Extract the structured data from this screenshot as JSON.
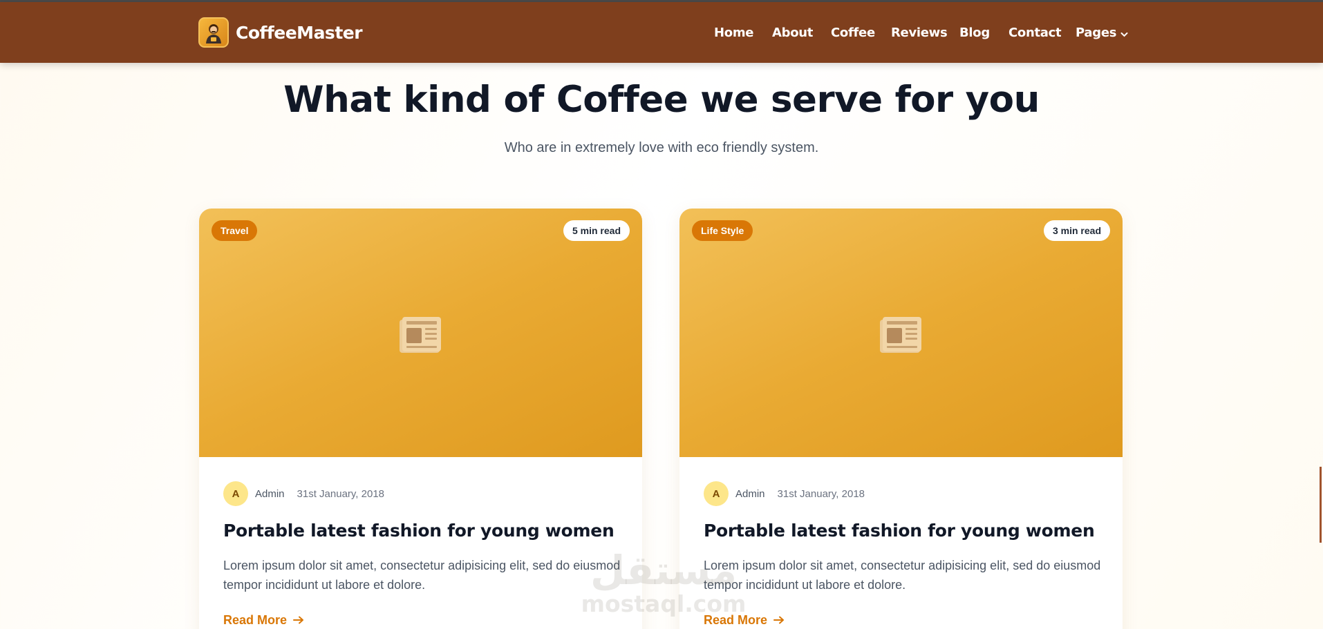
{
  "brand": {
    "name": "CoffeeMaster",
    "logo_icon": "barista-logo-icon"
  },
  "nav": {
    "items": [
      {
        "label": "Home"
      },
      {
        "label": "About"
      },
      {
        "label": "Coffee"
      },
      {
        "label": "Reviews"
      },
      {
        "label": "Blog"
      },
      {
        "label": "Contact"
      },
      {
        "label": "Pages",
        "icon": "chevron-down-icon"
      }
    ]
  },
  "section": {
    "title": "What kind of Coffee we serve for you",
    "subtitle": "Who are in extremely love with eco friendly system."
  },
  "posts": [
    {
      "category": "Travel",
      "read_time": "5 min read",
      "image_icon": "newspaper-icon",
      "avatar_initial": "A",
      "author": "Admin",
      "date": "31st January, 2018",
      "title": "Portable latest fashion for young women",
      "excerpt": "Lorem ipsum dolor sit amet, consectetur adipisicing elit, sed do eiusmod tempor incididunt ut labore et dolore.",
      "read_more": "Read More"
    },
    {
      "category": "Life Style",
      "read_time": "3 min read",
      "image_icon": "newspaper-icon",
      "avatar_initial": "A",
      "author": "Admin",
      "date": "31st January, 2018",
      "title": "Portable latest fashion for young women",
      "excerpt": "Lorem ipsum dolor sit amet, consectetur adipisicing elit, sed do eiusmod tempor incididunt ut labore et dolore.",
      "read_more": "Read More"
    }
  ],
  "watermark": {
    "arabic": "مستقل",
    "latin": "mostaql.com"
  },
  "colors": {
    "header_bg": "#7f3f1d",
    "accent": "#d97706",
    "card_image": "#e9aa33",
    "avatar_bg": "#fde68a"
  }
}
